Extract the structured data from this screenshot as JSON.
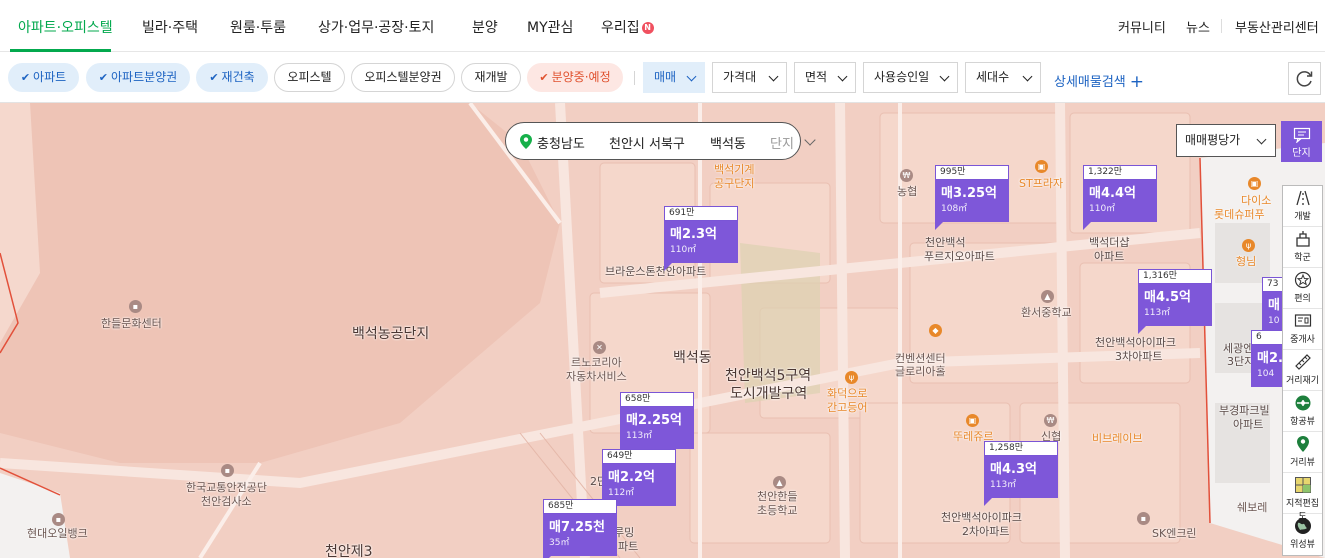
{
  "nav": {
    "left": [
      "아파트·오피스텔",
      "빌라·주택",
      "원룸·투룸",
      "상가·업무·공장·토지",
      "분양",
      "MY관심",
      "우리집"
    ],
    "new_badge": "N",
    "right": [
      "커뮤니티",
      "뉴스",
      "부동산관리센터"
    ]
  },
  "filters": {
    "chips": [
      {
        "label": "아파트",
        "check": "✔"
      },
      {
        "label": "아파트분양권",
        "check": "✔"
      },
      {
        "label": "재건축",
        "check": "✔"
      },
      {
        "label": "오피스텔"
      },
      {
        "label": "오피스텔분양권"
      },
      {
        "label": "재개발"
      },
      {
        "label": "분양중·예정",
        "check": "✔"
      }
    ],
    "dropdowns": [
      "매매",
      "가격대",
      "면적",
      "사용승인일",
      "세대수"
    ],
    "advanced_search": "상세매물검색",
    "plus": "+"
  },
  "location": {
    "province": "충청남도",
    "city": "천안시 서북구",
    "dong": "백석동",
    "complex": "단지"
  },
  "map_controls": {
    "price_type": "매매평당가",
    "danji_label": "단지"
  },
  "tools": [
    "개발",
    "학군",
    "편의",
    "중개사",
    "거리재기",
    "항공뷰",
    "거리뷰",
    "지적편집도",
    "위성뷰"
  ],
  "markers": [
    {
      "top": "691만",
      "price": "매2.3억",
      "area": "110㎡"
    },
    {
      "top": "995만",
      "price": "매3.25억",
      "area": "108㎡"
    },
    {
      "top": "1,322만",
      "price": "매4.4억",
      "area": "110㎡"
    },
    {
      "top": "1,316만",
      "price": "매4.5억",
      "area": "113㎡"
    },
    {
      "top": "658만",
      "price": "매2.25억",
      "area": "113㎡"
    },
    {
      "top": "649만",
      "price": "매2.2억",
      "area": "112㎡"
    },
    {
      "top": "685만",
      "price": "매7.25천",
      "area": "35㎡"
    },
    {
      "top": "1,258만",
      "price": "매4.3억",
      "area": "113㎡"
    },
    {
      "top": "73",
      "price": "매",
      "area": "10"
    },
    {
      "top": "6",
      "price": "매2.",
      "area": "104"
    }
  ],
  "map_labels": {
    "hanteul": "한들문화센터",
    "baekseok_farm": "백석농공단지",
    "baekseok_dong": "백석동",
    "redev": [
      "천안백석5구역",
      "도시개발구역"
    ],
    "tool_complex": [
      "백석기계",
      "공구단지"
    ],
    "brown": "브라운스톤천안아파트",
    "renocorea": [
      "르노코리아",
      "자동차서비스"
    ],
    "nonghyup": "농협",
    "purgio": [
      "천안백석",
      "푸르지오아파트"
    ],
    "st_plaza": "ST프라자",
    "the_sharp": [
      "백석더샵",
      "아파트"
    ],
    "daiso": [
      "다이소",
      "롯데슈퍼푸"
    ],
    "hyeongnim": "형님",
    "hwanseo": "환서중학교",
    "convention": [
      "컨벤션센터",
      "글로리아홀"
    ],
    "ipark3": [
      "천안백석아이파크",
      "3차아파트"
    ],
    "saegwang": [
      "세광엔",
      "3단지"
    ],
    "bugyeong": [
      "부경파크빌",
      "아파트"
    ],
    "hwadeok": [
      "화덕으로",
      "간고등어"
    ],
    "touslesjours": "뚜레쥬르",
    "sinhyup": "신협",
    "bread": "비브레이브",
    "kotsa": [
      "한국교통안전공단",
      "천안검사소"
    ],
    "hyundai_oil": "현대오일뱅크",
    "hanteul_school": [
      "천안한들",
      "초등학교"
    ],
    "ipark2": [
      "천안백석아이파크",
      "2차아파트"
    ],
    "sk": "SK엔크린",
    "swebore": "쉐보레",
    "cheonan3": "천안제3",
    "rooming": [
      "루밍",
      "파트"
    ],
    "two_b": "2단"
  }
}
